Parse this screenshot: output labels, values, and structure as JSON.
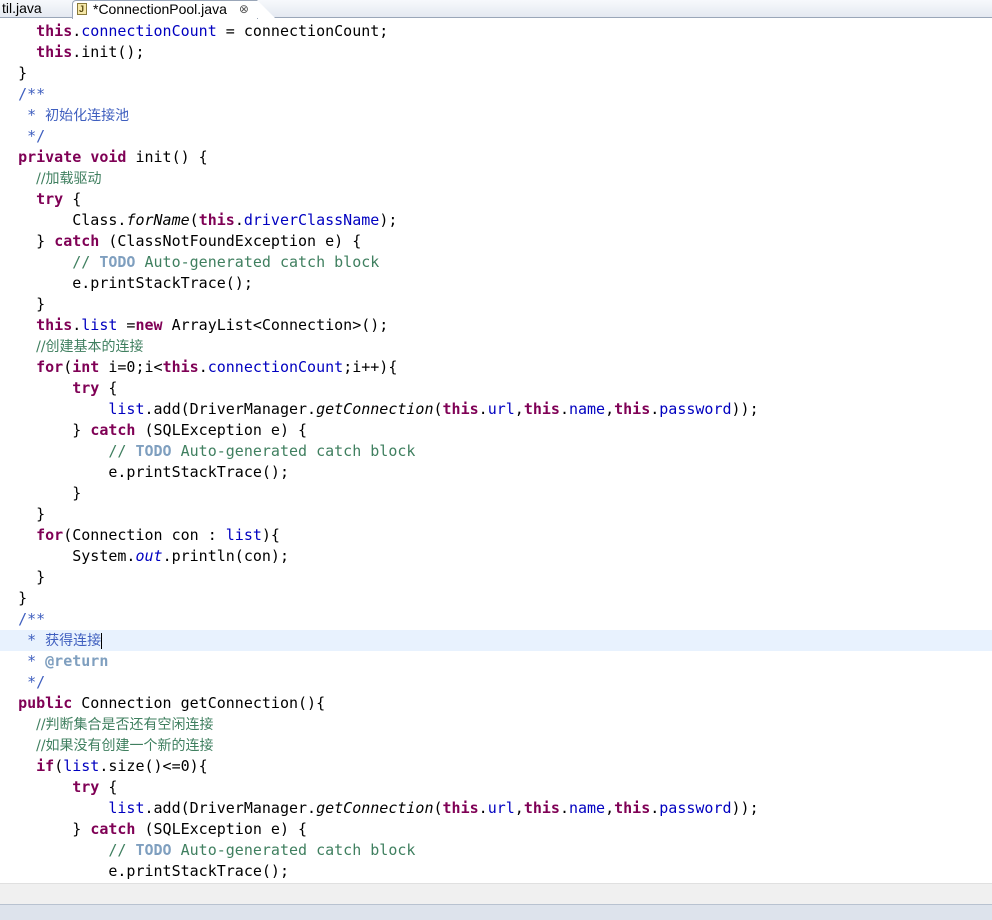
{
  "tabs": [
    {
      "label": "til.java",
      "active": false
    },
    {
      "label": "*ConnectionPool.java",
      "active": true,
      "icon": "java-file-icon",
      "close": "⊗"
    }
  ],
  "colors": {
    "keyword": "#7f0055",
    "field": "#0000c0",
    "comment": "#3f7f5f",
    "javadoc": "#3f5fbf",
    "javadoc_tag": "#7f9fbf",
    "current_line": "#e8f2fe"
  },
  "code": {
    "l01": {
      "kw": "this",
      "f": "connectionCount",
      "rest": " = connectionCount;"
    },
    "l02": {
      "kw": "this",
      "rest": ".init();"
    },
    "l03": "}",
    "l04": "/**",
    "l05": {
      "star": " * ",
      "text": "初始化连接池"
    },
    "l06": " */",
    "l07": {
      "kw1": "private",
      "kw2": "void",
      "rest": " init() {"
    },
    "l08": "//加载驱动",
    "l09": {
      "kw": "try",
      "rest": " {"
    },
    "l10": {
      "a": "Class.",
      "m": "forName",
      "b": "(",
      "kw": "this",
      "f": "driverClassName",
      "c": ");"
    },
    "l11": {
      "a": "} ",
      "kw": "catch",
      "rest": " (ClassNotFoundException e) {"
    },
    "l12": {
      "a": "// ",
      "todo": "TODO",
      "rest": " Auto-generated catch block"
    },
    "l13": "e.printStackTrace();",
    "l14": "}",
    "l15": {
      "kw1": "this",
      "f": "list",
      "mid": " =",
      "kw2": "new",
      "rest": " ArrayList<Connection>();"
    },
    "l16": "//创建基本的连接",
    "l17": {
      "kw1": "for",
      "a": "(",
      "kw2": "int",
      "b": " i=0;i<",
      "kw3": "this",
      "f": "connectionCount",
      "c": ";i++){"
    },
    "l18": {
      "kw": "try",
      "rest": " {"
    },
    "l19": {
      "f0": "list",
      "a": ".add(DriverManager.",
      "m": "getConnection",
      "b": "(",
      "kw1": "this",
      "f1": "url",
      "kw2": "this",
      "f2": "name",
      "kw3": "this",
      "f3": "password",
      "c": "));"
    },
    "l20": {
      "a": "} ",
      "kw": "catch",
      "rest": " (SQLException e) {"
    },
    "l21": {
      "a": "// ",
      "todo": "TODO",
      "rest": " Auto-generated catch block"
    },
    "l22": "e.printStackTrace();",
    "l23": "}",
    "l24": "}",
    "l25": {
      "kw": "for",
      "a": "(Connection con : ",
      "f": "list",
      "b": "){"
    },
    "l26": {
      "a": "System.",
      "sf": "out",
      "b": ".println(con);"
    },
    "l27": "}",
    "l28": "}",
    "l29": "/**",
    "l30": {
      "star": " * ",
      "text": "获得连接"
    },
    "l31": {
      "star": " * ",
      "tag": "@return"
    },
    "l32": " */",
    "l33": {
      "kw": "public",
      "rest": " Connection getConnection(){"
    },
    "l34": "//判断集合是否还有空闲连接",
    "l35": "//如果没有创建一个新的连接",
    "l36": {
      "kw": "if",
      "a": "(",
      "f": "list",
      "b": ".size()<=0){"
    },
    "l37": {
      "kw": "try",
      "rest": " {"
    },
    "l38": {
      "f0": "list",
      "a": ".add(DriverManager.",
      "m": "getConnection",
      "b": "(",
      "kw1": "this",
      "f1": "url",
      "kw2": "this",
      "f2": "name",
      "kw3": "this",
      "f3": "password",
      "c": "));"
    },
    "l39": {
      "a": "} ",
      "kw": "catch",
      "rest": " (SQLException e) {"
    },
    "l40": {
      "a": "// ",
      "todo": "TODO",
      "rest": " Auto-generated catch block"
    },
    "l41": "e.printStackTrace();"
  }
}
